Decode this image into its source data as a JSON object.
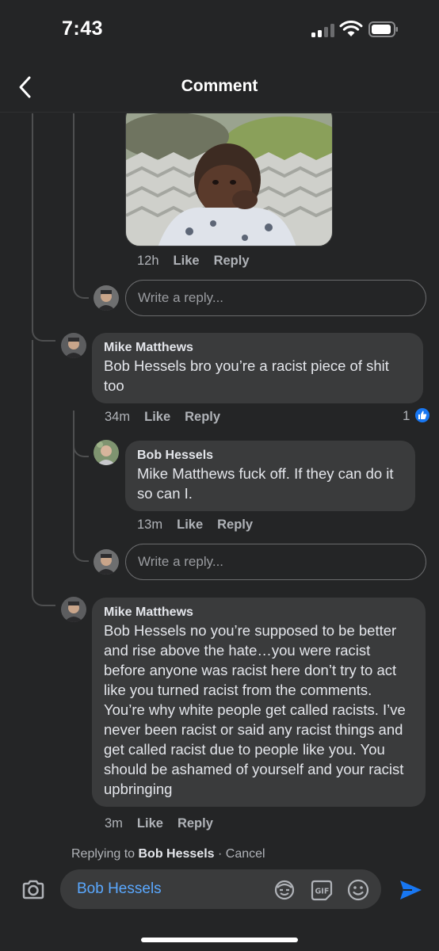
{
  "status": {
    "time": "7:43"
  },
  "nav": {
    "title": "Comment"
  },
  "first_reply": {
    "time": "12h",
    "like": "Like",
    "reply": "Reply"
  },
  "reply_box_1": {
    "placeholder": "Write a reply..."
  },
  "comment_1": {
    "author": "Mike Matthews",
    "text": "Bob Hessels bro you’re a racist piece of shit too",
    "time": "34m",
    "like": "Like",
    "reply": "Reply",
    "reactions": "1",
    "reaction_color": "#1877f2"
  },
  "reply_1": {
    "author": "Bob Hessels",
    "text": "Mike Matthews fuck off. If they can do it so can I.",
    "time": "13m",
    "like": "Like",
    "reply": "Reply"
  },
  "reply_box_2": {
    "placeholder": "Write a reply..."
  },
  "comment_2": {
    "author": "Mike Matthews",
    "text": "Bob Hessels no you’re supposed to be better and rise above the hate…you were racist before anyone was racist here don’t try to act like you turned racist from the comments. You’re why white people get called racists. I’ve never been racist or said any racist things and get called racist due to people like you. You should be ashamed of yourself and your racist upbringing",
    "time": "3m",
    "like": "Like",
    "reply": "Reply"
  },
  "replying": {
    "prefix": "Replying to ",
    "name": "Bob Hessels",
    "cancel": " · Cancel"
  },
  "composer": {
    "value": "Bob Hessels",
    "icons": [
      "camera-icon",
      "avatar-sticker-icon",
      "gif-icon",
      "emoji-icon",
      "send-icon"
    ],
    "accent": "#1877f2"
  }
}
